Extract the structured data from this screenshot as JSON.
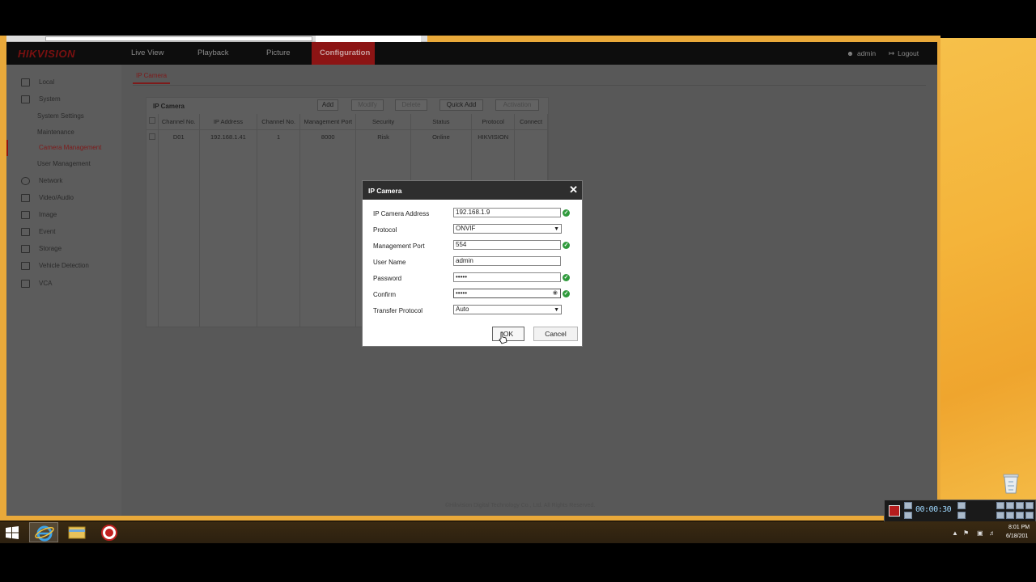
{
  "app": {
    "logo": "HIKVISION",
    "nav": [
      "Live View",
      "Playback",
      "Picture",
      "Configuration"
    ],
    "active_nav": "Configuration",
    "user": "admin",
    "logout": "Logout",
    "accent": "#8c1414"
  },
  "sidebar": {
    "items": [
      {
        "label": "Local",
        "icon": "monitor-icon"
      },
      {
        "label": "System",
        "icon": "system-icon"
      },
      {
        "label": "System Settings"
      },
      {
        "label": "Maintenance"
      },
      {
        "label": "Camera Management",
        "selected": true
      },
      {
        "label": "User Management"
      },
      {
        "label": "Network",
        "icon": "globe-icon"
      },
      {
        "label": "Video/Audio",
        "icon": "video-icon"
      },
      {
        "label": "Image",
        "icon": "image-icon"
      },
      {
        "label": "Event",
        "icon": "event-icon"
      },
      {
        "label": "Storage",
        "icon": "storage-icon"
      },
      {
        "label": "Vehicle Detection",
        "icon": "vehicle-icon"
      },
      {
        "label": "VCA",
        "icon": "vca-icon"
      }
    ]
  },
  "content": {
    "tab": "IP Camera",
    "panel_title": "IP Camera",
    "buttons": {
      "add": "Add",
      "modify": "Modify",
      "delete": "Delete",
      "quick_add": "Quick Add",
      "activation": "Activation"
    },
    "columns": [
      "Channel No.",
      "IP Address",
      "Channel No.",
      "Management Port",
      "Security",
      "Status",
      "Protocol",
      "Connect"
    ],
    "rows": [
      [
        "D01",
        "192.168.1.41",
        "1",
        "8000",
        "Risk",
        "Online",
        "HIKVISION",
        ""
      ]
    ],
    "footer": "©Hikvision Digital Technology Co., Ltd. All Rights Reserved."
  },
  "dialog": {
    "title": "IP Camera",
    "fields": {
      "ip_address": {
        "label": "IP Camera Address",
        "value": "192.168.1.9"
      },
      "protocol": {
        "label": "Protocol",
        "value": "ONVIF"
      },
      "port": {
        "label": "Management Port",
        "value": "554"
      },
      "username": {
        "label": "User Name",
        "value": "admin"
      },
      "password": {
        "label": "Password",
        "value": "•••••"
      },
      "confirm": {
        "label": "Confirm",
        "value": "•••••"
      },
      "transfer": {
        "label": "Transfer Protocol",
        "value": "Auto"
      }
    },
    "ok": "OK",
    "cancel": "Cancel",
    "valid_color": "#2f9a3c"
  },
  "recorder": {
    "time": "00:00:30"
  },
  "taskbar": {
    "apps": [
      "internet-explorer-icon",
      "file-explorer-icon",
      "recorder-app-icon"
    ],
    "time": "8:01 PM",
    "date": "6/18/201"
  }
}
